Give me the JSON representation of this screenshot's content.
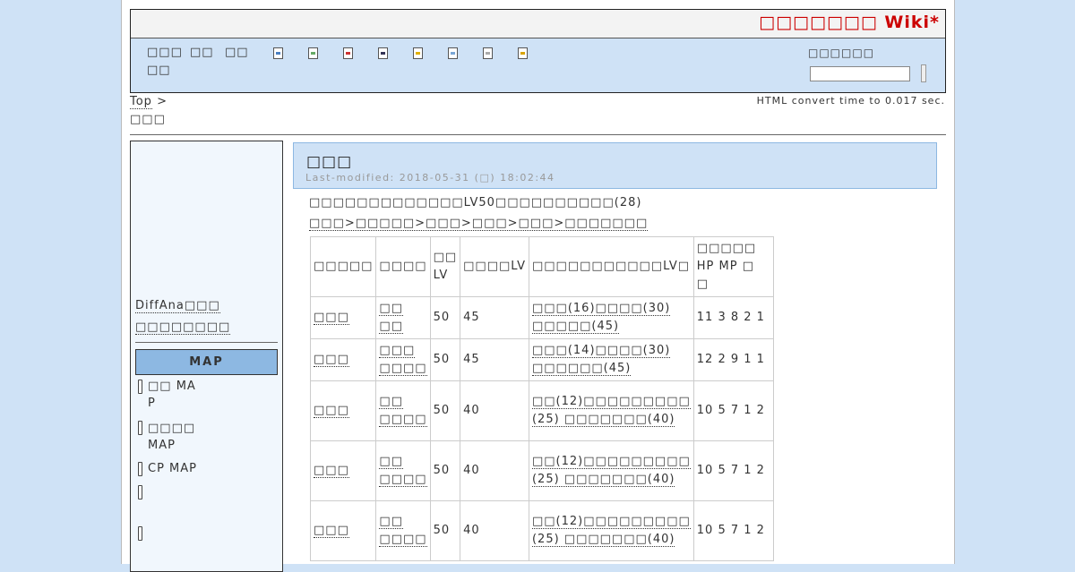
{
  "site": {
    "title": "□□□□□□□ Wiki*"
  },
  "nav": {
    "links": [
      "□□□",
      "□□",
      "□□",
      "□□"
    ],
    "icon_names": [
      "page-new-icon",
      "page-edit-icon",
      "page-delete-icon",
      "page-save-icon",
      "page-lock-icon",
      "page-copy-icon",
      "page-list-icon",
      "page-help-icon"
    ],
    "search_label": "□□□□□□"
  },
  "breadcrumb": {
    "top": "Top",
    "separator": ">",
    "page": "□□□"
  },
  "convert_time": "HTML convert time to 0.017 sec.",
  "menubar": {
    "links": [
      "DiffAna□□□",
      "□□□□□□□□"
    ],
    "map_header": "MAP",
    "map_items": [
      {
        "line1": "□□ MA",
        "line2": "P"
      },
      {
        "line1": "□□□□",
        "line2": "MAP"
      },
      {
        "line1": "CP MAP",
        "line2": ""
      },
      {
        "line1": "",
        "line2": ""
      },
      {
        "line1": "",
        "line2": ""
      }
    ]
  },
  "page": {
    "title": "□□□",
    "last_modified": "Last-modified: 2018-05-31 (□) 18:02:44",
    "intro": "□□□□□□□□□□□□□LV50□□□□□□□□□□(28)",
    "path": "□□□>□□□□□>□□□>□□□>□□□>□□□□□□□"
  },
  "table": {
    "headers": [
      "□□□□□",
      "□□□□",
      "□□ LV",
      "□□□□LV",
      "□□□□□□□□□□□LV□",
      "□□□□□ HP MP □ □"
    ],
    "rows": [
      {
        "name": "□□□",
        "class": "□□ □□",
        "lv": "50",
        "lv2": "45",
        "skills": "□□□(16)□□□□(30) □□□□□(45)",
        "stats": "11 3 8 2 1"
      },
      {
        "name": "□□□",
        "class": "□□□ □□□□",
        "lv": "50",
        "lv2": "45",
        "skills": "□□□(14)□□□□(30) □□□□□□(45)",
        "stats": "12 2 9 1 1"
      },
      {
        "name": "□□□",
        "class": "□□ □□□□",
        "lv": "50",
        "lv2": "40",
        "skills": "□□(12)□□□□□□□□□ (25) □□□□□□□(40)",
        "stats": "10 5 7 1 2"
      },
      {
        "name": "□□□",
        "class": "□□ □□□□",
        "lv": "50",
        "lv2": "40",
        "skills": "□□(12)□□□□□□□□□ (25) □□□□□□□(40)",
        "stats": "10 5 7 1 2"
      },
      {
        "name": "□□□",
        "class": "□□ □□□□",
        "lv": "50",
        "lv2": "40",
        "skills": "□□(12)□□□□□□□□□ (25) □□□□□□□(40)",
        "stats": "10 5 7 1 2"
      }
    ]
  },
  "colors": {
    "background": "#cfe2f6",
    "title": "#cc0000",
    "map_header": "#8db8e2",
    "sidebar": "#f1f7fd"
  }
}
